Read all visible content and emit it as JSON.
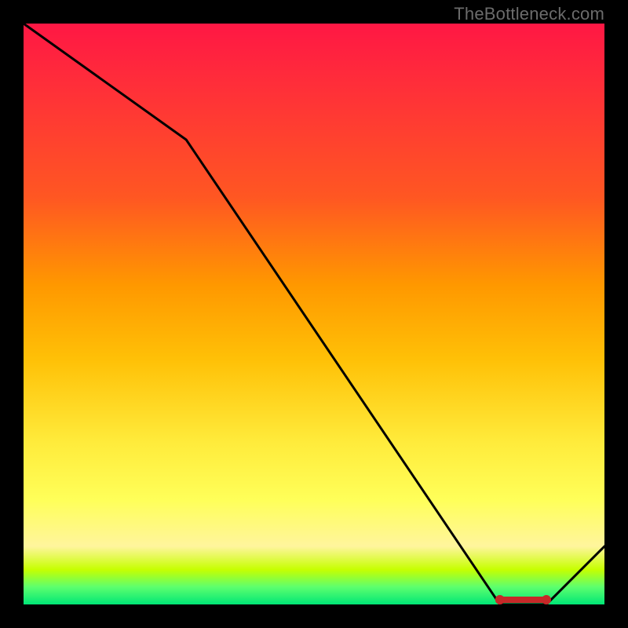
{
  "attribution": "TheBottleneck.com",
  "chart_data": {
    "type": "line",
    "title": "",
    "xlabel": "",
    "ylabel": "",
    "xlim": [
      0,
      100
    ],
    "ylim": [
      0,
      100
    ],
    "x": [
      0,
      28,
      82,
      90,
      100
    ],
    "values": [
      100,
      80,
      0,
      0,
      10
    ],
    "highlight_band_x": [
      82,
      90
    ],
    "gradient_stops": [
      {
        "pct": 0,
        "color": "#ff1744"
      },
      {
        "pct": 30,
        "color": "#ff5722"
      },
      {
        "pct": 58,
        "color": "#ffc107"
      },
      {
        "pct": 82,
        "color": "#ffff59"
      },
      {
        "pct": 97,
        "color": "#5dff6e"
      },
      {
        "pct": 100,
        "color": "#00e676"
      }
    ]
  }
}
